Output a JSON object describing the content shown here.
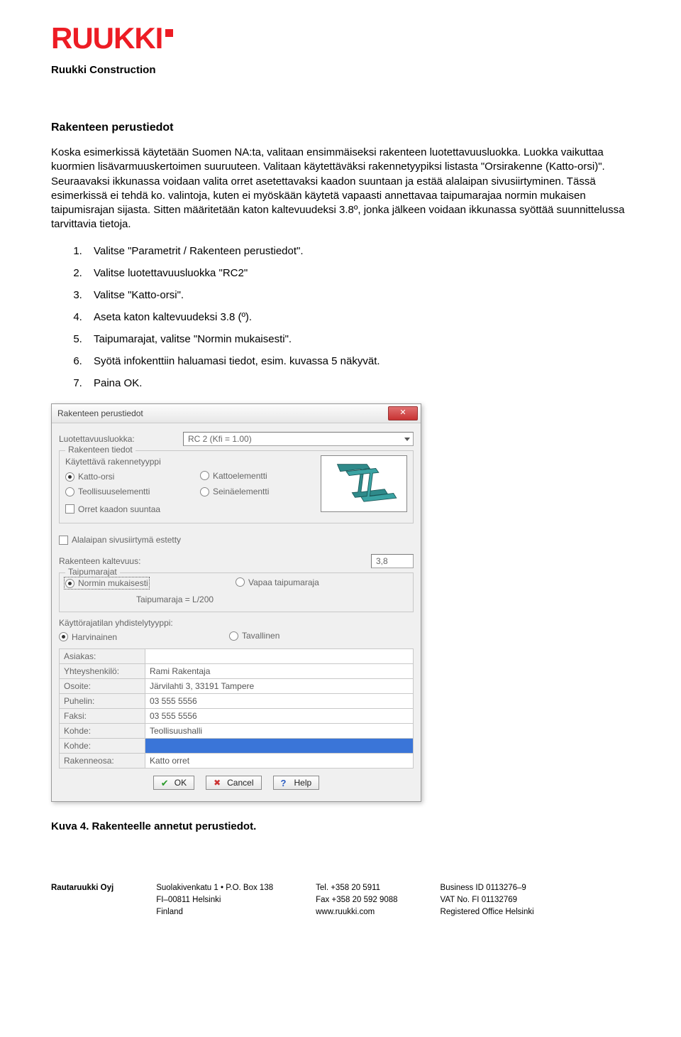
{
  "header": {
    "logo_text": "RUUKKI",
    "company": "Ruukki Construction"
  },
  "title": "Rakenteen perustiedot",
  "paragraph": "Koska esimerkissä käytetään Suomen NA:ta, valitaan ensimmäiseksi rakenteen luotettavuusluokka. Luokka vaikuttaa kuormien lisävarmuuskertoimen suuruuteen. Valitaan käytettäväksi rakennetyypiksi listasta \"Orsirakenne (Katto-orsi)\". Seuraavaksi ikkunassa voidaan valita orret asetettavaksi kaadon suuntaan ja estää alalaipan sivusiirtyminen. Tässä esimerkissä ei tehdä ko. valintoja, kuten ei myöskään käytetä vapaasti annettavaa taipumarajaa normin mukaisen taipumisrajan sijasta. Sitten määritetään katon kaltevuudeksi 3.8º, jonka jälkeen voidaan ikkunassa syöttää suunnittelussa tarvittavia tietoja.",
  "steps": [
    "Valitse \"Parametrit / Rakenteen perustiedot\".",
    "Valitse luotettavuusluokka \"RC2\"",
    "Valitse \"Katto-orsi\".",
    "Aseta katon kaltevuudeksi 3.8 (º).",
    "Taipumarajat, valitse \"Normin mukaisesti\".",
    "Syötä infokenttiin haluamasi tiedot, esim. kuvassa 5 näkyvät.",
    "Paina OK."
  ],
  "dialog": {
    "title": "Rakenteen perustiedot",
    "reliability": {
      "label": "Luotettavuusluokka:",
      "value": "RC 2  (Kfi = 1.00)"
    },
    "structure_group": {
      "legend": "Rakenteen tiedot",
      "subtitle": "Käytettävä rakennetyyppi",
      "opts": {
        "a": "Katto-orsi",
        "b": "Kattoelementti",
        "c": "Teollisuuselementti",
        "d": "Seinäelementti"
      },
      "check": "Orret kaadon suuntaa"
    },
    "lateral_check": "Alalaipan sivusiirtymä estetty",
    "slope": {
      "label": "Rakenteen kaltevuus:",
      "value": "3,8"
    },
    "deflection": {
      "legend": "Taipumarajat",
      "a": "Normin mukaisesti",
      "b": "Vapaa taipumaraja",
      "formula": "Taipumaraja =   L/200"
    },
    "combo": {
      "label": "Käyttörajatilan yhdistelytyyppi:",
      "a": "Harvinainen",
      "b": "Tavallinen"
    },
    "info": {
      "asiakas": {
        "k": "Asiakas:",
        "v": ""
      },
      "yht": {
        "k": "Yhteyshenkilö:",
        "v": "Rami Rakentaja"
      },
      "osoite": {
        "k": "Osoite:",
        "v": "Järvilahti 3, 33191 Tampere"
      },
      "puh": {
        "k": "Puhelin:",
        "v": "03 555 5556"
      },
      "faksi": {
        "k": "Faksi:",
        "v": "03 555 5556"
      },
      "kohde1": {
        "k": "Kohde:",
        "v": "Teollisuushalli"
      },
      "kohde2": {
        "k": "Kohde:",
        "v": ""
      },
      "osa": {
        "k": "Rakenneosa:",
        "v": "Katto orret"
      }
    },
    "buttons": {
      "ok": "OK",
      "cancel": "Cancel",
      "help": "Help"
    }
  },
  "caption": "Kuva 4. Rakenteelle annetut perustiedot.",
  "footer": {
    "c1": "Rautaruukki Oyj",
    "c2": [
      "Suolakivenkatu 1 • P.O. Box 138",
      "FI–00811 Helsinki",
      "Finland"
    ],
    "c3": [
      "Tel. +358 20 5911",
      "Fax +358 20 592 9088",
      "www.ruukki.com"
    ],
    "c4": [
      "Business ID 0113276–9",
      "VAT No. FI 01132769",
      "Registered Office Helsinki"
    ]
  }
}
